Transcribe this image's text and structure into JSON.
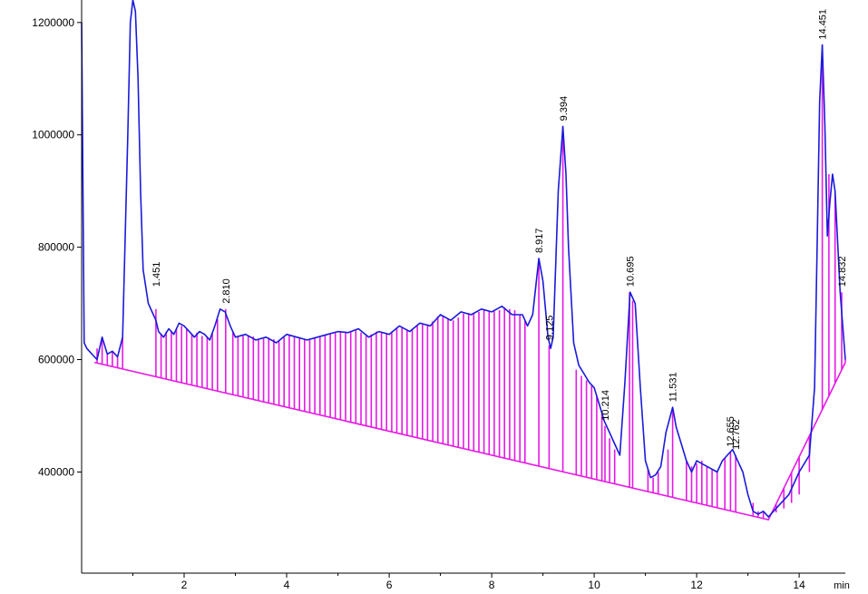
{
  "chart_data": {
    "type": "line",
    "title": "",
    "xlabel": "min",
    "ylabel": "",
    "xlim": [
      0,
      14.9
    ],
    "ylim": [
      220000,
      1240000
    ],
    "x_ticks": [
      2,
      4,
      6,
      8,
      10,
      12,
      14
    ],
    "x_tick_labels": [
      "2",
      "4",
      "6",
      "8",
      "10",
      "12",
      "14"
    ],
    "y_ticks": [
      400000,
      600000,
      800000,
      1000000,
      1200000
    ],
    "y_tick_labels": [
      "400000",
      "600000",
      "800000",
      "1000000",
      "1200000"
    ],
    "colors": {
      "signal": "#1a1adb",
      "integration": "#e619e6",
      "axis": "#000000"
    },
    "baseline": {
      "x": [
        0.25,
        13.4,
        14.9
      ],
      "y": [
        595000,
        315000,
        595000
      ]
    },
    "signal": {
      "x": [
        0.0,
        0.05,
        0.1,
        0.2,
        0.3,
        0.4,
        0.5,
        0.6,
        0.7,
        0.8,
        0.9,
        0.95,
        1.0,
        1.05,
        1.1,
        1.15,
        1.2,
        1.3,
        1.4,
        1.45,
        1.5,
        1.6,
        1.7,
        1.8,
        1.9,
        2.0,
        2.1,
        2.2,
        2.3,
        2.4,
        2.5,
        2.6,
        2.7,
        2.8,
        2.9,
        3.0,
        3.2,
        3.4,
        3.6,
        3.8,
        4.0,
        4.2,
        4.4,
        4.6,
        4.8,
        5.0,
        5.2,
        5.4,
        5.6,
        5.8,
        6.0,
        6.2,
        6.4,
        6.6,
        6.8,
        7.0,
        7.2,
        7.4,
        7.6,
        7.8,
        8.0,
        8.2,
        8.4,
        8.6,
        8.7,
        8.8,
        8.92,
        9.0,
        9.1,
        9.15,
        9.2,
        9.3,
        9.39,
        9.45,
        9.5,
        9.6,
        9.7,
        9.8,
        9.9,
        10.0,
        10.1,
        10.2,
        10.3,
        10.4,
        10.5,
        10.6,
        10.7,
        10.8,
        10.9,
        11.0,
        11.1,
        11.2,
        11.3,
        11.4,
        11.53,
        11.6,
        11.7,
        11.8,
        11.9,
        12.0,
        12.2,
        12.4,
        12.5,
        12.6,
        12.7,
        12.8,
        12.9,
        13.0,
        13.1,
        13.2,
        13.3,
        13.4,
        13.6,
        13.8,
        14.0,
        14.2,
        14.3,
        14.35,
        14.4,
        14.45,
        14.5,
        14.55,
        14.6,
        14.65,
        14.7,
        14.8,
        14.9
      ],
      "y": [
        1200000,
        630000,
        620000,
        610000,
        600000,
        640000,
        610000,
        615000,
        605000,
        640000,
        1000000,
        1200000,
        1240000,
        1220000,
        1100000,
        900000,
        760000,
        700000,
        680000,
        670000,
        650000,
        640000,
        655000,
        645000,
        665000,
        660000,
        650000,
        640000,
        650000,
        645000,
        635000,
        660000,
        690000,
        685000,
        660000,
        640000,
        645000,
        635000,
        640000,
        630000,
        645000,
        640000,
        635000,
        640000,
        645000,
        650000,
        648000,
        655000,
        640000,
        650000,
        645000,
        660000,
        650000,
        665000,
        660000,
        680000,
        670000,
        685000,
        680000,
        690000,
        685000,
        695000,
        680000,
        680000,
        660000,
        680000,
        780000,
        740000,
        640000,
        620000,
        640000,
        900000,
        1015000,
        930000,
        800000,
        630000,
        590000,
        575000,
        560000,
        550000,
        520000,
        490000,
        470000,
        450000,
        430000,
        560000,
        720000,
        700000,
        550000,
        420000,
        390000,
        395000,
        410000,
        470000,
        515000,
        480000,
        450000,
        420000,
        400000,
        420000,
        410000,
        400000,
        420000,
        430000,
        440000,
        420000,
        400000,
        360000,
        330000,
        325000,
        330000,
        320000,
        340000,
        360000,
        400000,
        430000,
        550000,
        800000,
        1060000,
        1160000,
        1020000,
        820000,
        880000,
        930000,
        900000,
        720000,
        600000
      ]
    },
    "integration_markers": {
      "x": [
        0.3,
        0.4,
        0.5,
        0.6,
        0.7,
        0.8,
        1.45,
        1.55,
        1.65,
        1.75,
        1.85,
        1.95,
        2.05,
        2.15,
        2.25,
        2.35,
        2.45,
        2.55,
        2.65,
        2.81,
        2.95,
        3.05,
        3.15,
        3.25,
        3.35,
        3.45,
        3.55,
        3.65,
        3.75,
        3.85,
        3.95,
        4.05,
        4.15,
        4.25,
        4.35,
        4.45,
        4.55,
        4.65,
        4.75,
        4.85,
        4.95,
        5.05,
        5.15,
        5.25,
        5.35,
        5.45,
        5.55,
        5.65,
        5.75,
        5.85,
        5.95,
        6.05,
        6.15,
        6.25,
        6.35,
        6.45,
        6.55,
        6.65,
        6.75,
        6.85,
        6.95,
        7.05,
        7.15,
        7.25,
        7.35,
        7.45,
        7.55,
        7.65,
        7.75,
        7.85,
        7.95,
        8.05,
        8.15,
        8.25,
        8.35,
        8.45,
        8.55,
        8.65,
        8.92,
        9.12,
        9.39,
        9.65,
        9.75,
        9.85,
        9.95,
        10.05,
        10.15,
        10.21,
        10.3,
        10.4,
        10.69,
        10.75,
        11.05,
        11.15,
        11.25,
        11.44,
        11.53,
        11.8,
        11.9,
        12.0,
        12.1,
        12.2,
        12.3,
        12.4,
        12.55,
        12.66,
        12.76,
        13.1,
        13.2,
        13.3,
        13.45,
        13.55,
        13.7,
        13.85,
        14.0,
        14.2,
        14.45,
        14.58,
        14.7,
        14.83,
        14.9
      ],
      "y": [
        620000,
        640000,
        612000,
        615000,
        606000,
        640000,
        690000,
        645000,
        650000,
        650000,
        655000,
        660000,
        655000,
        645000,
        648000,
        642000,
        640000,
        648000,
        672000,
        690000,
        648000,
        640000,
        642000,
        643000,
        641000,
        636000,
        637000,
        639000,
        636000,
        633000,
        640000,
        644000,
        642000,
        640000,
        637000,
        636000,
        638000,
        640000,
        643000,
        645000,
        648000,
        649000,
        650000,
        651000,
        652000,
        648000,
        642000,
        645000,
        650000,
        648000,
        646000,
        650000,
        656000,
        658000,
        652000,
        655000,
        660000,
        662000,
        663000,
        668000,
        677000,
        678000,
        672000,
        670000,
        675000,
        682000,
        683000,
        682000,
        685000,
        688000,
        687000,
        687000,
        688000,
        693000,
        690000,
        688000,
        680000,
        670000,
        780000,
        625000,
        1015000,
        582000,
        571000,
        563000,
        555000,
        535000,
        505000,
        482000,
        460000,
        440000,
        720000,
        705000,
        405000,
        390000,
        400000,
        440000,
        515000,
        420000,
        410000,
        415000,
        420000,
        410000,
        404000,
        400000,
        425000,
        435000,
        430000,
        345000,
        330000,
        328000,
        325000,
        328000,
        335000,
        345000,
        360000,
        400000,
        1160000,
        930000,
        900000,
        720000,
        600000
      ]
    },
    "peak_labels": [
      {
        "x": 1.451,
        "y": 720000,
        "text": "1.451"
      },
      {
        "x": 2.81,
        "y": 690000,
        "text": "2.810"
      },
      {
        "x": 8.917,
        "y": 780000,
        "text": "8.917"
      },
      {
        "x": 9.125,
        "y": 625000,
        "text": "9.125"
      },
      {
        "x": 9.394,
        "y": 1015000,
        "text": "9.394"
      },
      {
        "x": 10.214,
        "y": 482000,
        "text": "10.214"
      },
      {
        "x": 10.695,
        "y": 720000,
        "text": "10.695"
      },
      {
        "x": 11.531,
        "y": 515000,
        "text": "11.531"
      },
      {
        "x": 12.655,
        "y": 435000,
        "text": "12.655"
      },
      {
        "x": 12.762,
        "y": 430000,
        "text": "12.762"
      },
      {
        "x": 14.451,
        "y": 1160000,
        "text": "14.451"
      },
      {
        "x": 14.832,
        "y": 720000,
        "text": "14.832"
      }
    ]
  }
}
